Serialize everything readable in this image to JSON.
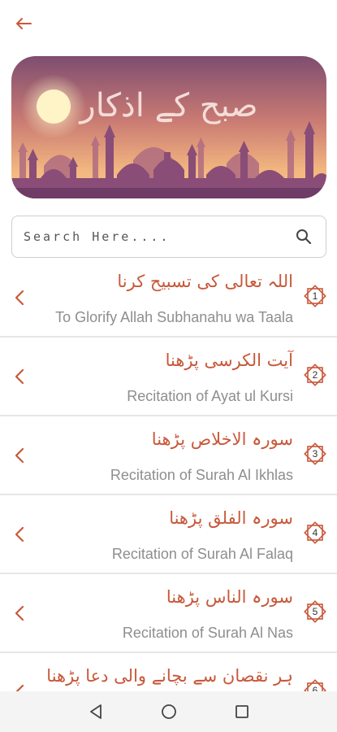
{
  "colors": {
    "accent": "#c8583a",
    "subtitle": "#8e8e8e",
    "divider": "#e6e6e6"
  },
  "header": {
    "back_icon": "arrow-left-icon"
  },
  "banner": {
    "title": "صبح کے اذکار"
  },
  "search": {
    "placeholder": "Search Here....",
    "value": "",
    "icon": "search-icon"
  },
  "items": [
    {
      "number": "1",
      "urdu": "اللہ تعالی کی تسبیح کرنا",
      "english": "To Glorify Allah Subhanahu wa Taala"
    },
    {
      "number": "2",
      "urdu": "آیت الکرسی پڑھنا",
      "english": "Recitation of Ayat ul Kursi"
    },
    {
      "number": "3",
      "urdu": "سورہ الاخلاص پڑھنا",
      "english": "Recitation of Surah Al Ikhlas"
    },
    {
      "number": "4",
      "urdu": "سورہ الفلق پڑھنا",
      "english": "Recitation of Surah Al Falaq"
    },
    {
      "number": "5",
      "urdu": "سورہ الناس پڑھنا",
      "english": "Recitation of Surah Al Nas"
    },
    {
      "number": "6",
      "urdu": "ہر نقصان سے بچانے والی دعا پڑھنا",
      "english": ""
    }
  ],
  "navbar": {
    "icons": [
      "back-triangle-icon",
      "home-circle-icon",
      "recents-square-icon"
    ]
  }
}
